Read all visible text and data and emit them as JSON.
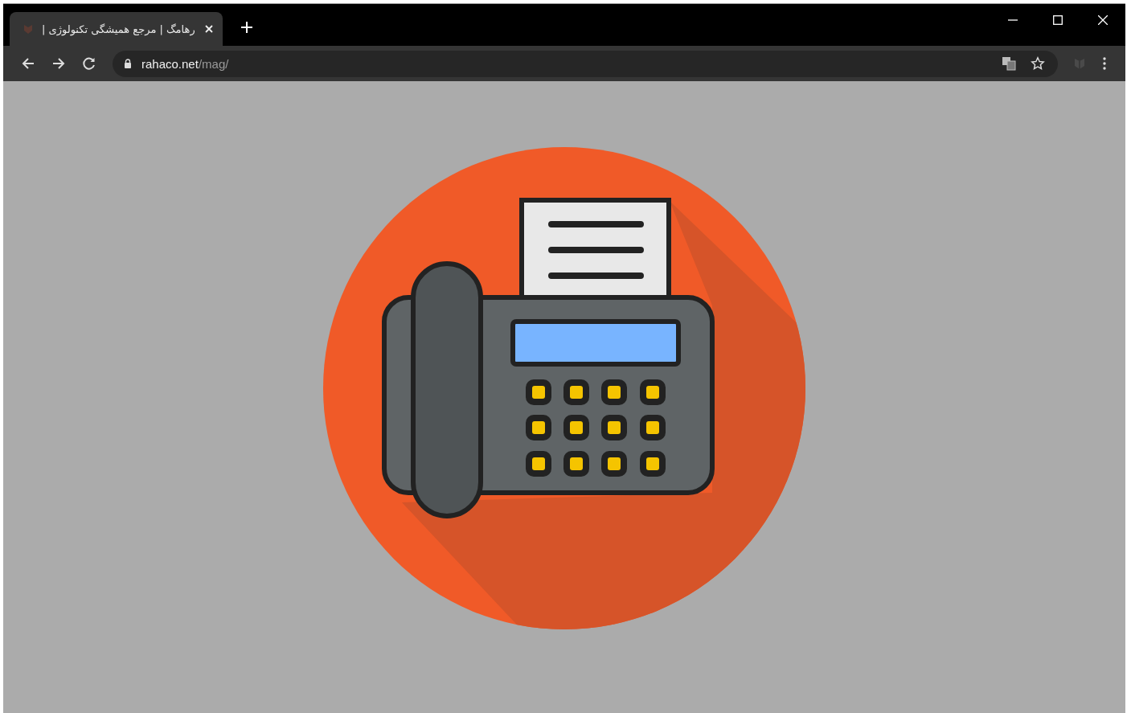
{
  "tabs": [
    {
      "title": "رهامگ | مرجع همیشگی تکنولوژی |",
      "selected": true
    }
  ],
  "address": {
    "host": "rahaco.net",
    "path": "/mag/"
  }
}
